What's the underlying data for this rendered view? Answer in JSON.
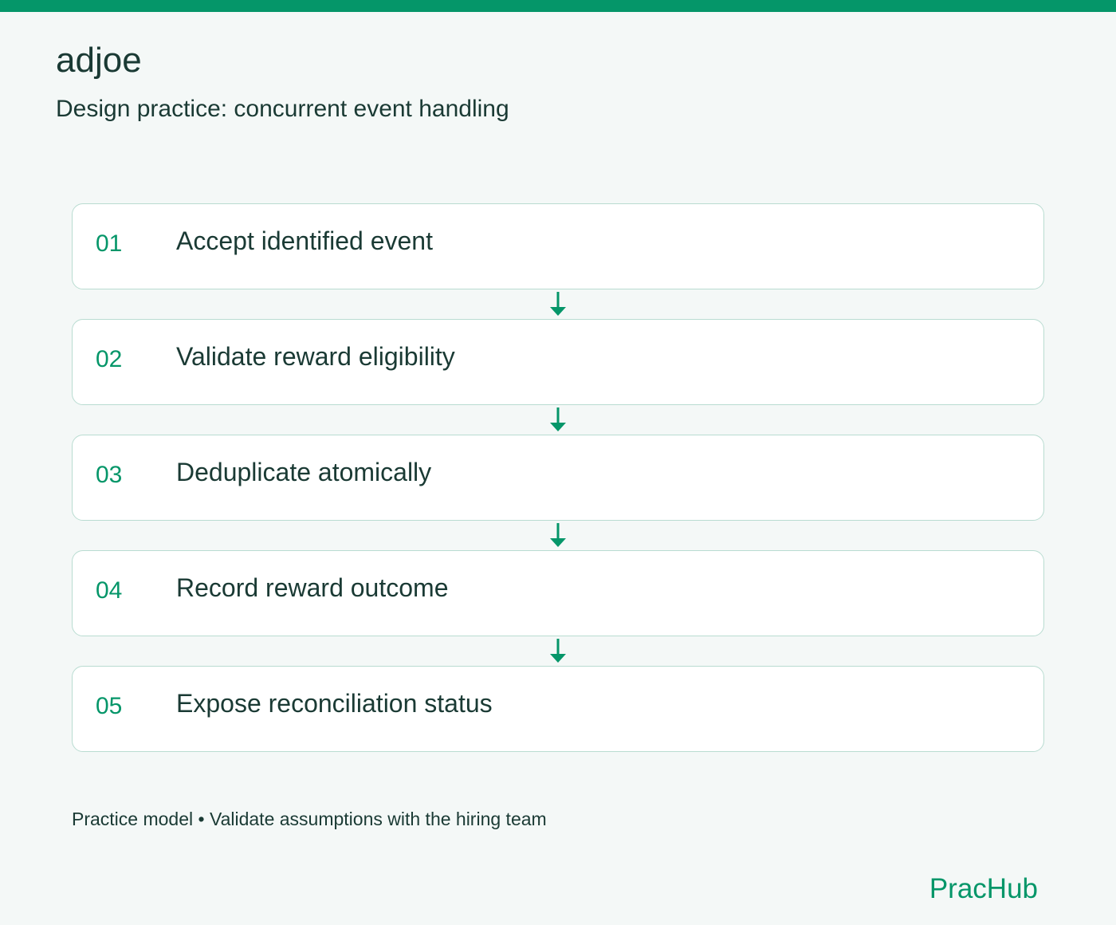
{
  "header": {
    "company": "adjoe",
    "subtitle": "Design practice: concurrent event handling"
  },
  "steps": [
    {
      "number": "01",
      "label": "Accept identified event"
    },
    {
      "number": "02",
      "label": "Validate reward eligibility"
    },
    {
      "number": "03",
      "label": "Deduplicate atomically"
    },
    {
      "number": "04",
      "label": "Record reward outcome"
    },
    {
      "number": "05",
      "label": "Expose reconciliation status"
    }
  ],
  "footer": {
    "note": "Practice model • Validate assumptions with the hiring team",
    "brand": "PracHub"
  },
  "colors": {
    "accent": "#059669",
    "text": "#1a3a34",
    "background": "#f4f8f7",
    "card_border": "#b9dcd1"
  },
  "icons": {
    "connector": "arrow-down-icon"
  }
}
